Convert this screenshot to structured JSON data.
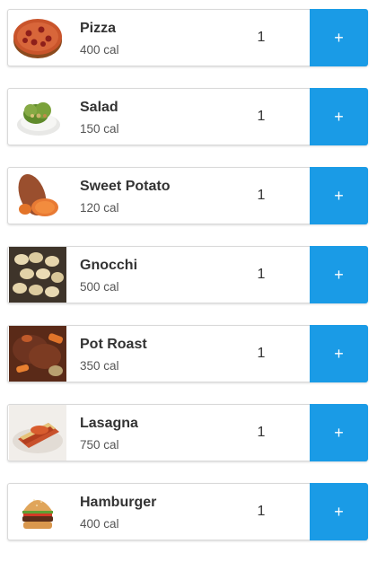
{
  "colors": {
    "add_button": "#1a9be6",
    "card_border": "#d9d9d9",
    "title_text": "#333333"
  },
  "items": [
    {
      "name": "Pizza",
      "calories": "400 cal",
      "quantity": "1",
      "add_label": "+",
      "image_icon": "pizza-image"
    },
    {
      "name": "Salad",
      "calories": "150 cal",
      "quantity": "1",
      "add_label": "+",
      "image_icon": "salad-image"
    },
    {
      "name": "Sweet Potato",
      "calories": "120 cal",
      "quantity": "1",
      "add_label": "+",
      "image_icon": "sweet-potato-image"
    },
    {
      "name": "Gnocchi",
      "calories": "500 cal",
      "quantity": "1",
      "add_label": "+",
      "image_icon": "gnocchi-image"
    },
    {
      "name": "Pot Roast",
      "calories": "350 cal",
      "quantity": "1",
      "add_label": "+",
      "image_icon": "pot-roast-image"
    },
    {
      "name": "Lasagna",
      "calories": "750 cal",
      "quantity": "1",
      "add_label": "+",
      "image_icon": "lasagna-image"
    },
    {
      "name": "Hamburger",
      "calories": "400 cal",
      "quantity": "1",
      "add_label": "+",
      "image_icon": "hamburger-image"
    }
  ]
}
